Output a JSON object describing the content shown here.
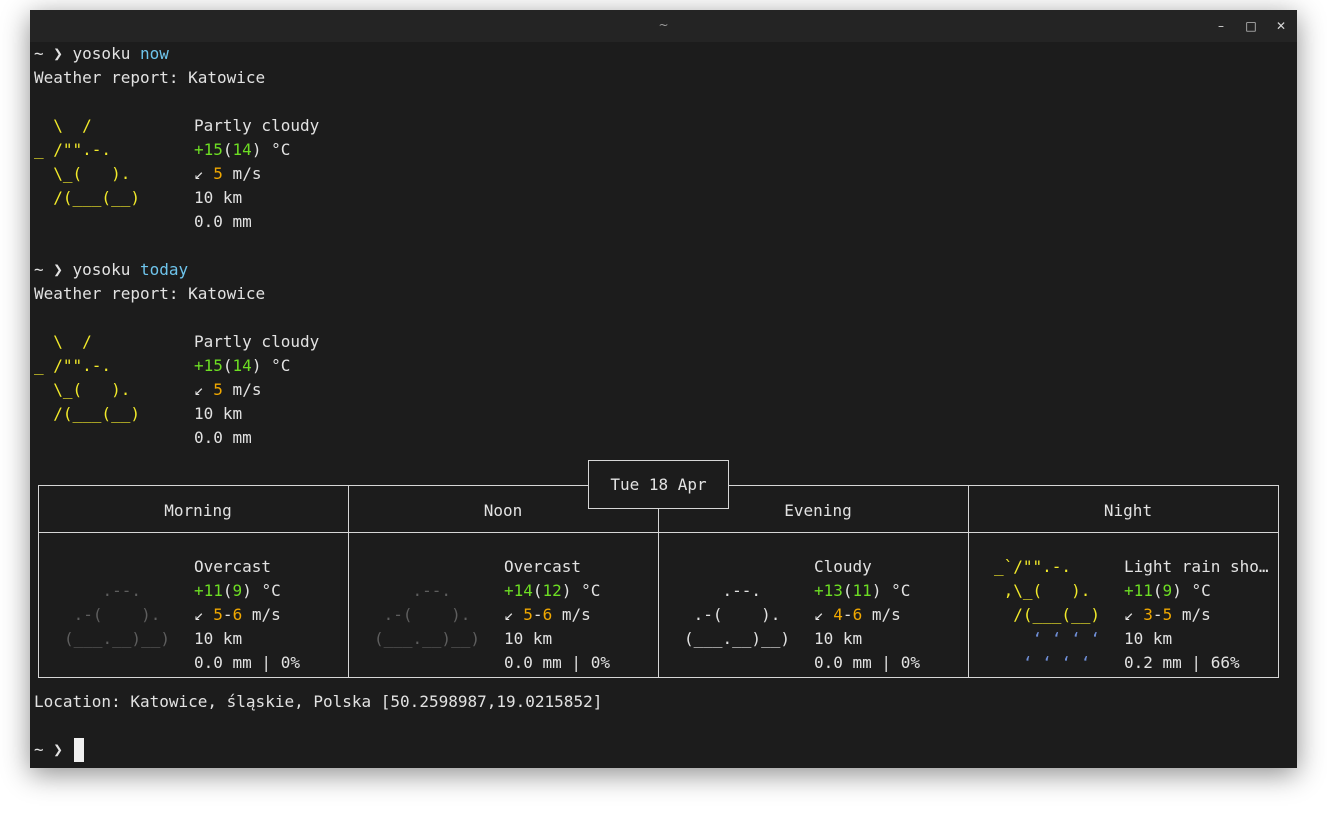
{
  "window": {
    "title": "~",
    "minimize": "–",
    "maximize": "□",
    "close": "✕"
  },
  "prompt": "~ ❯ ",
  "commands": [
    {
      "program": "yosoku",
      "arg": "now"
    },
    {
      "program": "yosoku",
      "arg": "today"
    }
  ],
  "report_title": "Weather report: Katowice",
  "current": {
    "art": [
      "  \\  /      ",
      "_ /\"\".-.    ",
      "  \\_(   ).  ",
      "  /(___(__) "
    ],
    "condition": "Partly cloudy",
    "temp": "+15",
    "feels": "14",
    "temp_unit": " °C",
    "wind_arrow": "↙",
    "wind": "5",
    "wind_unit": " m/s",
    "visibility": "10 km",
    "precip": "0.0 mm"
  },
  "day_label": "Tue 18 Apr",
  "periods": [
    {
      "name": "Morning",
      "art": [
        "    .--.    ",
        " .-(    ).  ",
        "(___.__)__) "
      ],
      "condition": "Overcast",
      "temp": "+11",
      "feels": "9",
      "wind_lo": "5",
      "wind_hi": "6",
      "visibility": "10 km",
      "precip": "0.0 mm | 0%"
    },
    {
      "name": "Noon",
      "art": [
        "    .--.    ",
        " .-(    ).  ",
        "(___.__)__) "
      ],
      "condition": "Overcast",
      "temp": "+14",
      "feels": "12",
      "wind_lo": "5",
      "wind_hi": "6",
      "visibility": "10 km",
      "precip": "0.0 mm | 0%"
    },
    {
      "name": "Evening",
      "art": [
        "    .--.    ",
        " .-(    ).  ",
        "(___.__)__) "
      ],
      "condition": "Cloudy",
      "temp": "+13",
      "feels": "11",
      "wind_lo": "4",
      "wind_hi": "6",
      "visibility": "10 km",
      "precip": "0.0 mm | 0%"
    },
    {
      "name": "Night",
      "art": [
        "_`/\"\".-.    ",
        " ,\\_(   ).  ",
        "  /(___(__) ",
        "    ‘ ‘ ‘ ‘ ",
        "   ‘ ‘ ‘ ‘  "
      ],
      "condition": "Light rain sho…",
      "temp": "+11",
      "feels": "9",
      "wind_lo": "3",
      "wind_hi": "5",
      "visibility": "10 km",
      "precip": "0.2 mm | 66%"
    }
  ],
  "location": "Location: Katowice, śląskie, Polska [50.2598987,19.0215852]",
  "colors": {
    "sun": "#f2ea2a",
    "temp": "#6dde23",
    "wind": "#f0a800",
    "command_arg": "#6ec4ec",
    "cloud": "#5e5e5e",
    "rain": "#6f8ed6"
  }
}
